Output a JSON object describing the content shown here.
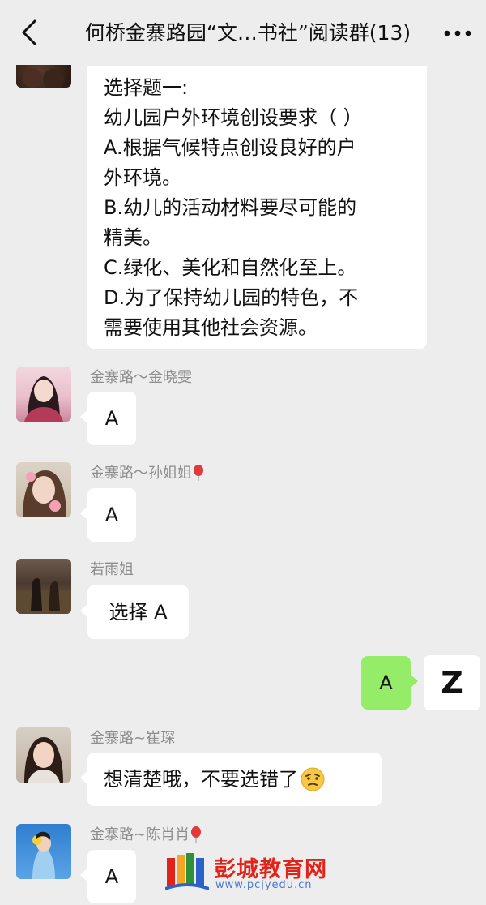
{
  "header": {
    "title": "何桥金寨路园“文…书社”阅读群(13)"
  },
  "messages": {
    "question": {
      "lines": [
        "选择题一:",
        "幼儿园户外环境创设要求（ ）",
        "A.根据气候特点创设良好的户",
        "外环境。",
        "B.幼儿的活动材料要尽可能的",
        "精美。",
        "C.绿化、美化和自然化至上。",
        "D.为了保持幼儿园的特色，不",
        "需要使用其他社会资源。"
      ]
    },
    "m1": {
      "sender": "金寨路～金晓雯",
      "text": "A"
    },
    "m2": {
      "sender": "金寨路～孙姐姐",
      "text": "A"
    },
    "m3": {
      "sender": "若雨姐",
      "text": "选择 A"
    },
    "mine": {
      "text": "A",
      "avatar_letter": "Z"
    },
    "m4": {
      "sender": "金寨路~崔琛",
      "text": "想清楚哦，不要选错了"
    },
    "m5": {
      "sender": "金寨路~陈肖肖",
      "text": "A"
    }
  },
  "watermark": {
    "name": "彭城教育网",
    "url": "www.pcjyedu.cn"
  },
  "colors": {
    "background": "#ededed",
    "bubble_incoming": "#ffffff",
    "bubble_outgoing": "#95ec69",
    "sender_name": "#8d8d8d",
    "watermark_red": "#e2231a"
  },
  "icons": [
    "back-arrow-icon",
    "more-dots-icon",
    "balloon-icon",
    "thinking-face-icon",
    "books-logo-icon"
  ]
}
